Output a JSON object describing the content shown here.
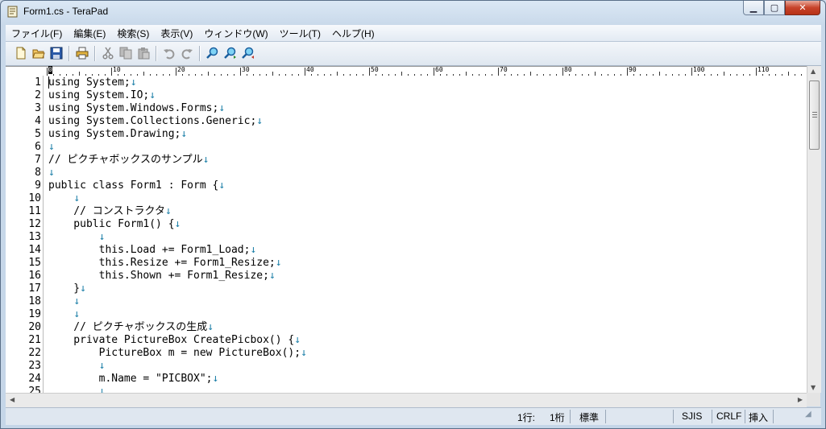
{
  "window": {
    "title": "Form1.cs - TeraPad"
  },
  "menu": [
    "ファイル(F)",
    "編集(E)",
    "検索(S)",
    "表示(V)",
    "ウィンドウ(W)",
    "ツール(T)",
    "ヘルプ(H)"
  ],
  "toolbar": [
    "new-file-icon",
    "open-folder-icon",
    "save-icon",
    "print-icon",
    "cut-icon",
    "copy-icon",
    "paste-icon",
    "undo-icon",
    "redo-icon",
    "find-icon",
    "find-next-icon",
    "find-prev-icon"
  ],
  "ruler": {
    "labels": [
      "0",
      "10",
      "20",
      "30",
      "40",
      "50",
      "60",
      "70",
      "80",
      "90",
      "100",
      "110"
    ]
  },
  "editor": {
    "eol_mark": "↓",
    "lines": [
      {
        "n": "1",
        "text": "using System;"
      },
      {
        "n": "2",
        "text": "using System.IO;"
      },
      {
        "n": "3",
        "text": "using System.Windows.Forms;"
      },
      {
        "n": "4",
        "text": "using System.Collections.Generic;"
      },
      {
        "n": "5",
        "text": "using System.Drawing;"
      },
      {
        "n": "6",
        "text": ""
      },
      {
        "n": "7",
        "text": "// ピクチャボックスのサンプル"
      },
      {
        "n": "8",
        "text": ""
      },
      {
        "n": "9",
        "text": "public class Form1 : Form {"
      },
      {
        "n": "10",
        "text": "    "
      },
      {
        "n": "11",
        "text": "    // コンストラクタ"
      },
      {
        "n": "12",
        "text": "    public Form1() {"
      },
      {
        "n": "13",
        "text": "        "
      },
      {
        "n": "14",
        "text": "        this.Load += Form1_Load;"
      },
      {
        "n": "15",
        "text": "        this.Resize += Form1_Resize;"
      },
      {
        "n": "16",
        "text": "        this.Shown += Form1_Resize;"
      },
      {
        "n": "17",
        "text": "    }"
      },
      {
        "n": "18",
        "text": "    "
      },
      {
        "n": "19",
        "text": "    "
      },
      {
        "n": "20",
        "text": "    // ピクチャボックスの生成"
      },
      {
        "n": "21",
        "text": "    private PictureBox CreatePicbox() {"
      },
      {
        "n": "22",
        "text": "        PictureBox m = new PictureBox();"
      },
      {
        "n": "23",
        "text": "        "
      },
      {
        "n": "24",
        "text": "        m.Name = \"PICBOX\";"
      },
      {
        "n": "25",
        "text": "        "
      }
    ]
  },
  "status": {
    "line": "1行:",
    "col": "1桁",
    "mode": "標準",
    "encoding": "SJIS",
    "newline": "CRLF",
    "insert": "挿入"
  }
}
